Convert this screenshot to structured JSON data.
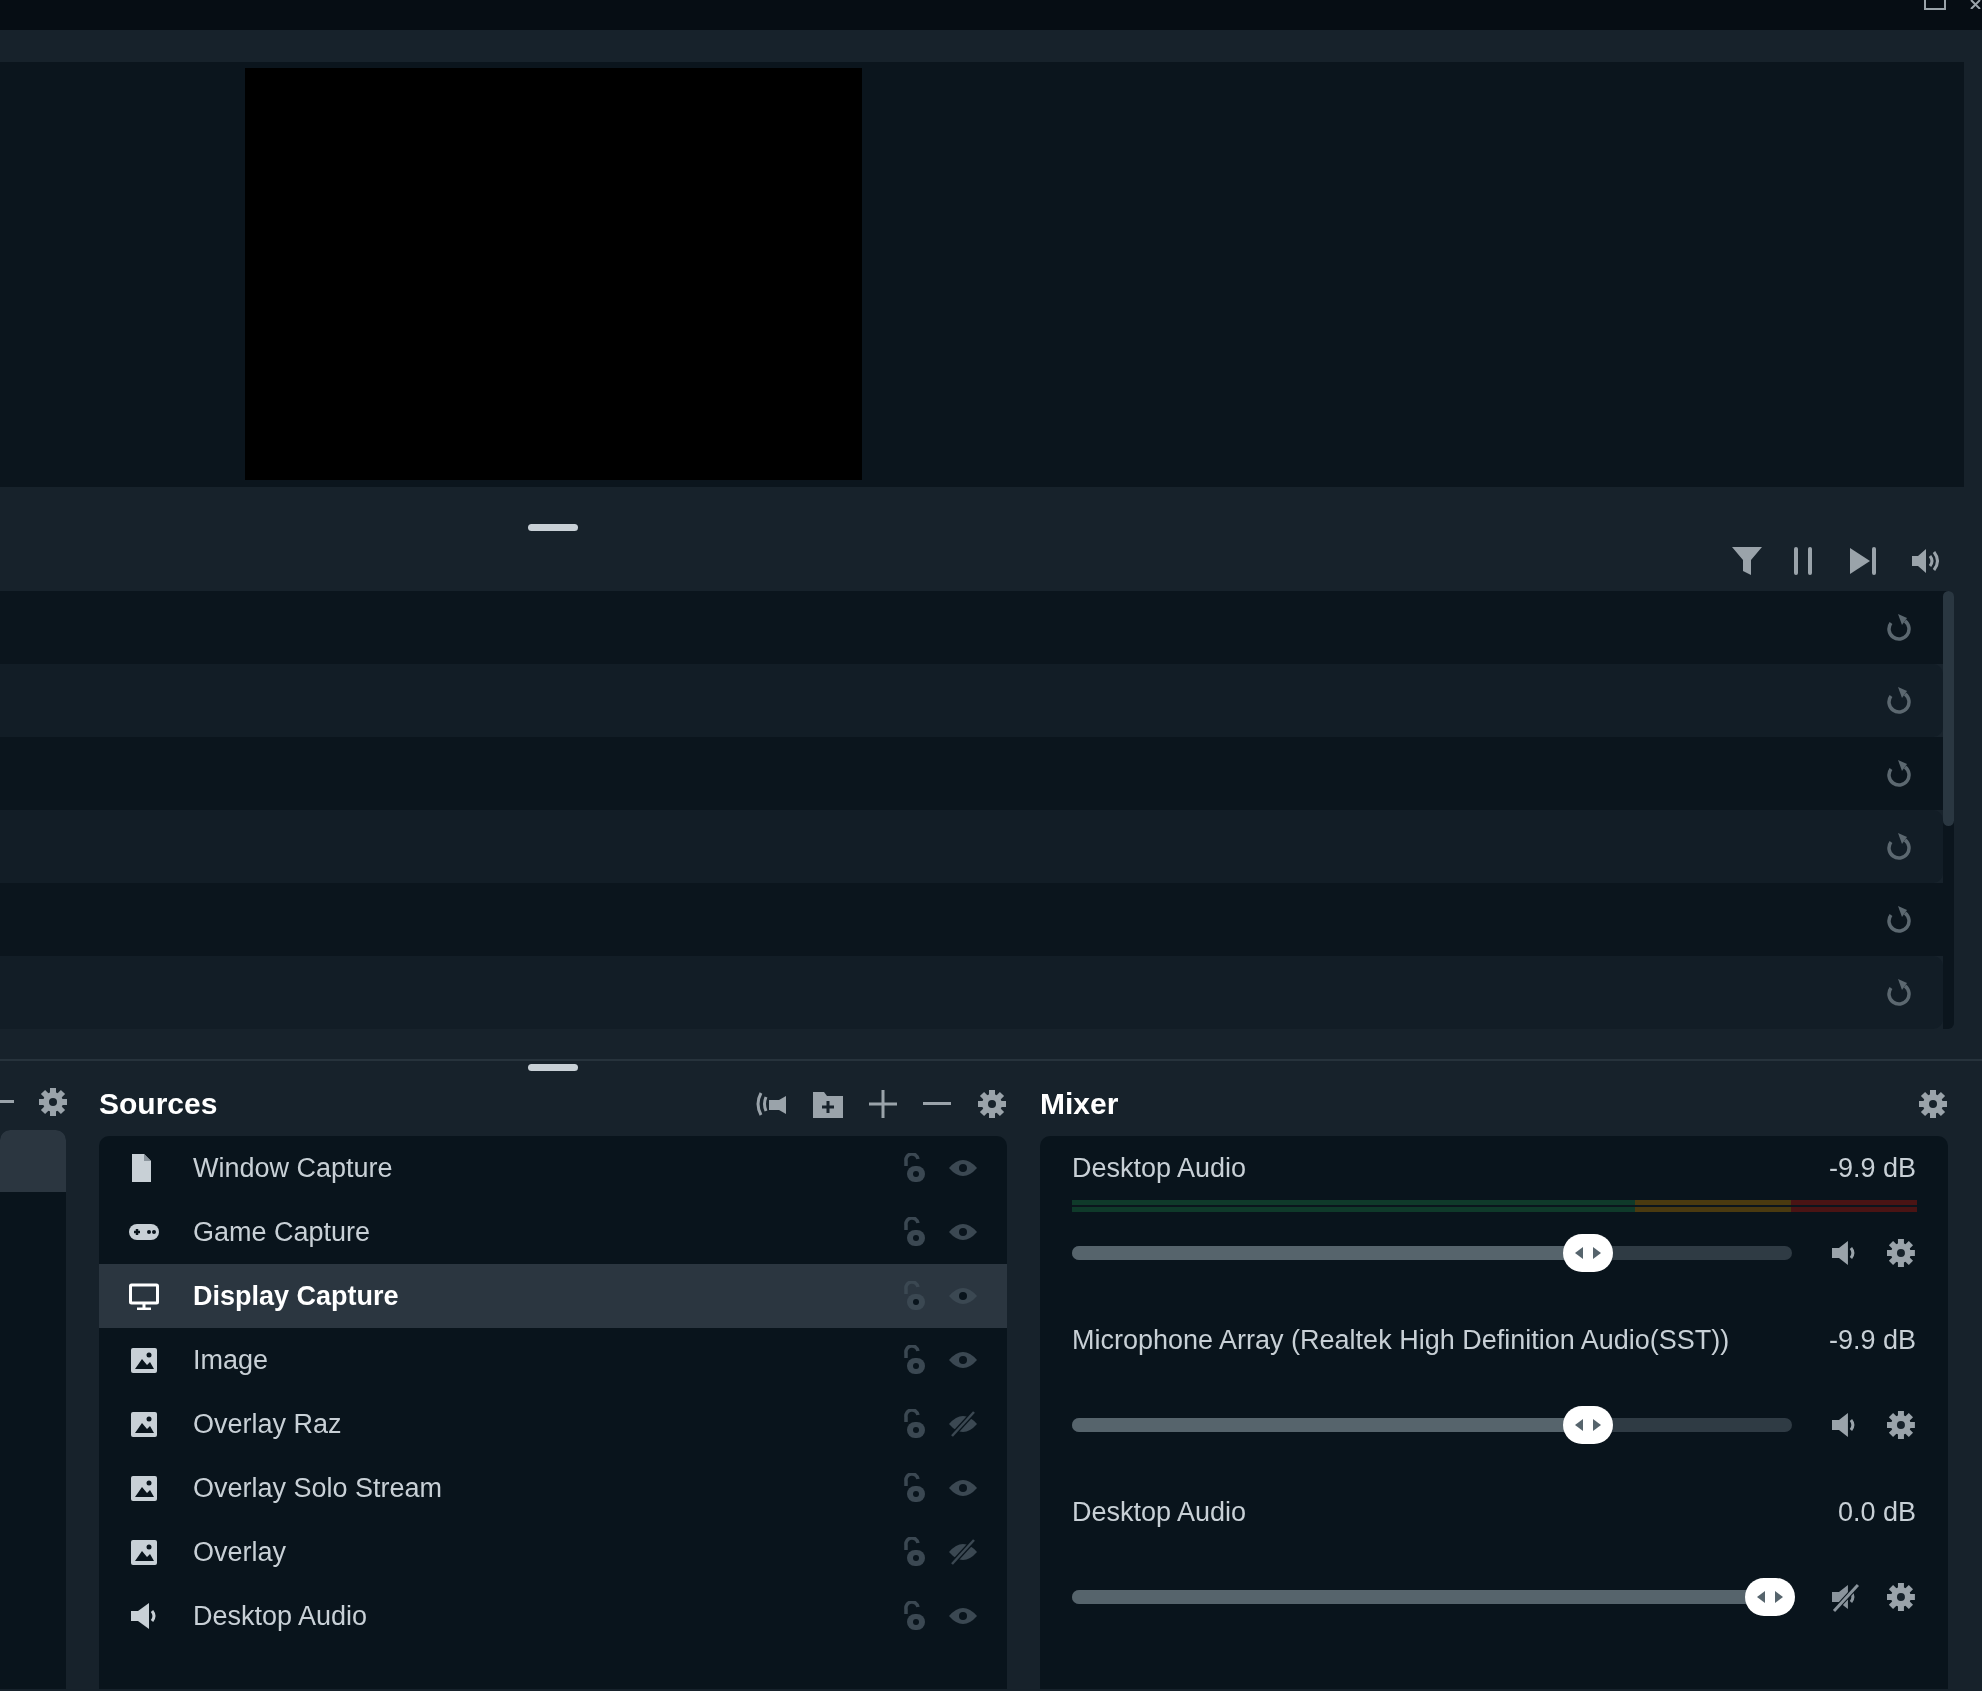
{
  "left_panel": {
    "items": [
      {
        "selected": true
      }
    ]
  },
  "event_rows": [
    {
      "kind": "reset"
    },
    {
      "kind": "reset"
    },
    {
      "kind": "reset"
    },
    {
      "kind": "reset"
    },
    {
      "kind": "reset"
    },
    {
      "kind": "reset"
    }
  ],
  "sources": {
    "title": "Sources",
    "items": [
      {
        "name": "Window Capture",
        "kind": "window",
        "selected": false,
        "visible": true
      },
      {
        "name": "Game Capture",
        "kind": "game",
        "selected": false,
        "visible": true
      },
      {
        "name": "Display Capture",
        "kind": "display",
        "selected": true,
        "visible": true
      },
      {
        "name": "Image",
        "kind": "image",
        "selected": false,
        "visible": true
      },
      {
        "name": "Overlay Raz",
        "kind": "image",
        "selected": false,
        "visible": false
      },
      {
        "name": "Overlay Solo Stream",
        "kind": "image",
        "selected": false,
        "visible": true
      },
      {
        "name": "Overlay",
        "kind": "image",
        "selected": false,
        "visible": false
      },
      {
        "name": "Desktop Audio",
        "kind": "audio",
        "selected": false,
        "visible": true
      }
    ]
  },
  "mixer": {
    "title": "Mixer",
    "channels": [
      {
        "name": "Desktop Audio",
        "reading": "-9.9 dB",
        "level": 0.73,
        "muted": false,
        "meter": true
      },
      {
        "name": "Microphone Array (Realtek High Definition Audio(SST))",
        "reading": "-9.9 dB",
        "level": 0.73,
        "muted": false,
        "meter": false
      },
      {
        "name": "Desktop Audio",
        "reading": "0.0 dB",
        "level": 1.0,
        "muted": true,
        "meter": false
      }
    ]
  }
}
